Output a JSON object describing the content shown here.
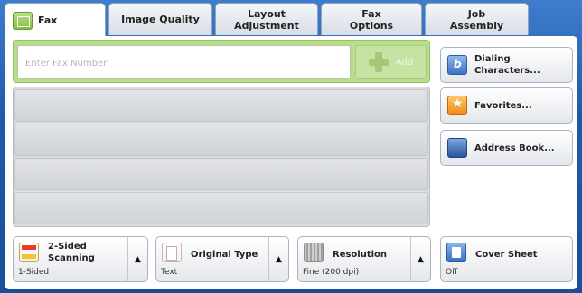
{
  "tabs": [
    {
      "label": "Fax"
    },
    {
      "label": "Image Quality"
    },
    {
      "label": "Layout\nAdjustment"
    },
    {
      "label": "Fax\nOptions"
    },
    {
      "label": "Job\nAssembly"
    }
  ],
  "fax": {
    "placeholder": "Enter Fax Number",
    "add_label": "Add"
  },
  "side_buttons": {
    "dialing": "Dialing\nCharacters...",
    "favorites": "Favorites...",
    "address_book": "Address Book...",
    "cover_sheet": "Cover Sheet",
    "cover_sheet_value": "Off"
  },
  "bottom": {
    "two_sided_label": "2-Sided\nScanning",
    "two_sided_value": "1-Sided",
    "original_label": "Original Type",
    "original_value": "Text",
    "resolution_label": "Resolution",
    "resolution_value": "Fine (200 dpi)"
  },
  "icons": {
    "arrow_up": "▲"
  }
}
